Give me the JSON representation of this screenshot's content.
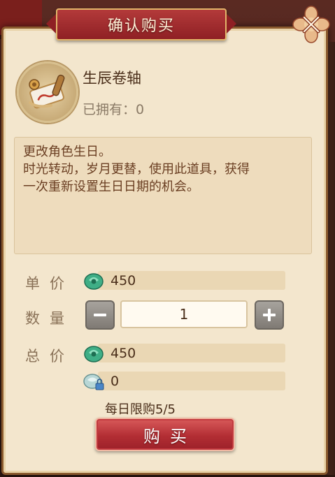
{
  "dialog": {
    "title": "确认购买",
    "close_icon": "close-icon"
  },
  "item": {
    "name": "生辰卷轴",
    "owned_label": "已拥有：",
    "owned_count": "0",
    "icon": "scroll-icon"
  },
  "description": {
    "line1": "更改角色生日。",
    "line2": "时光转动，岁月更替，使用此道具，获得",
    "line3": "一次重新设置生日日期的机会。"
  },
  "price": {
    "unit_label": "单价",
    "unit_value": "450",
    "quantity_label": "数量",
    "quantity_value": "1",
    "total_label": "总价",
    "total_value": "450",
    "bound_value": "0",
    "currency_icon": "jade-icon",
    "bound_currency_icon": "bound-jade-icon"
  },
  "daily_limit": "每日限购5/5",
  "buy_button": "购买",
  "colors": {
    "accent_red": "#b32e34",
    "panel": "#f3e6cd",
    "jade": "#3fae86"
  }
}
